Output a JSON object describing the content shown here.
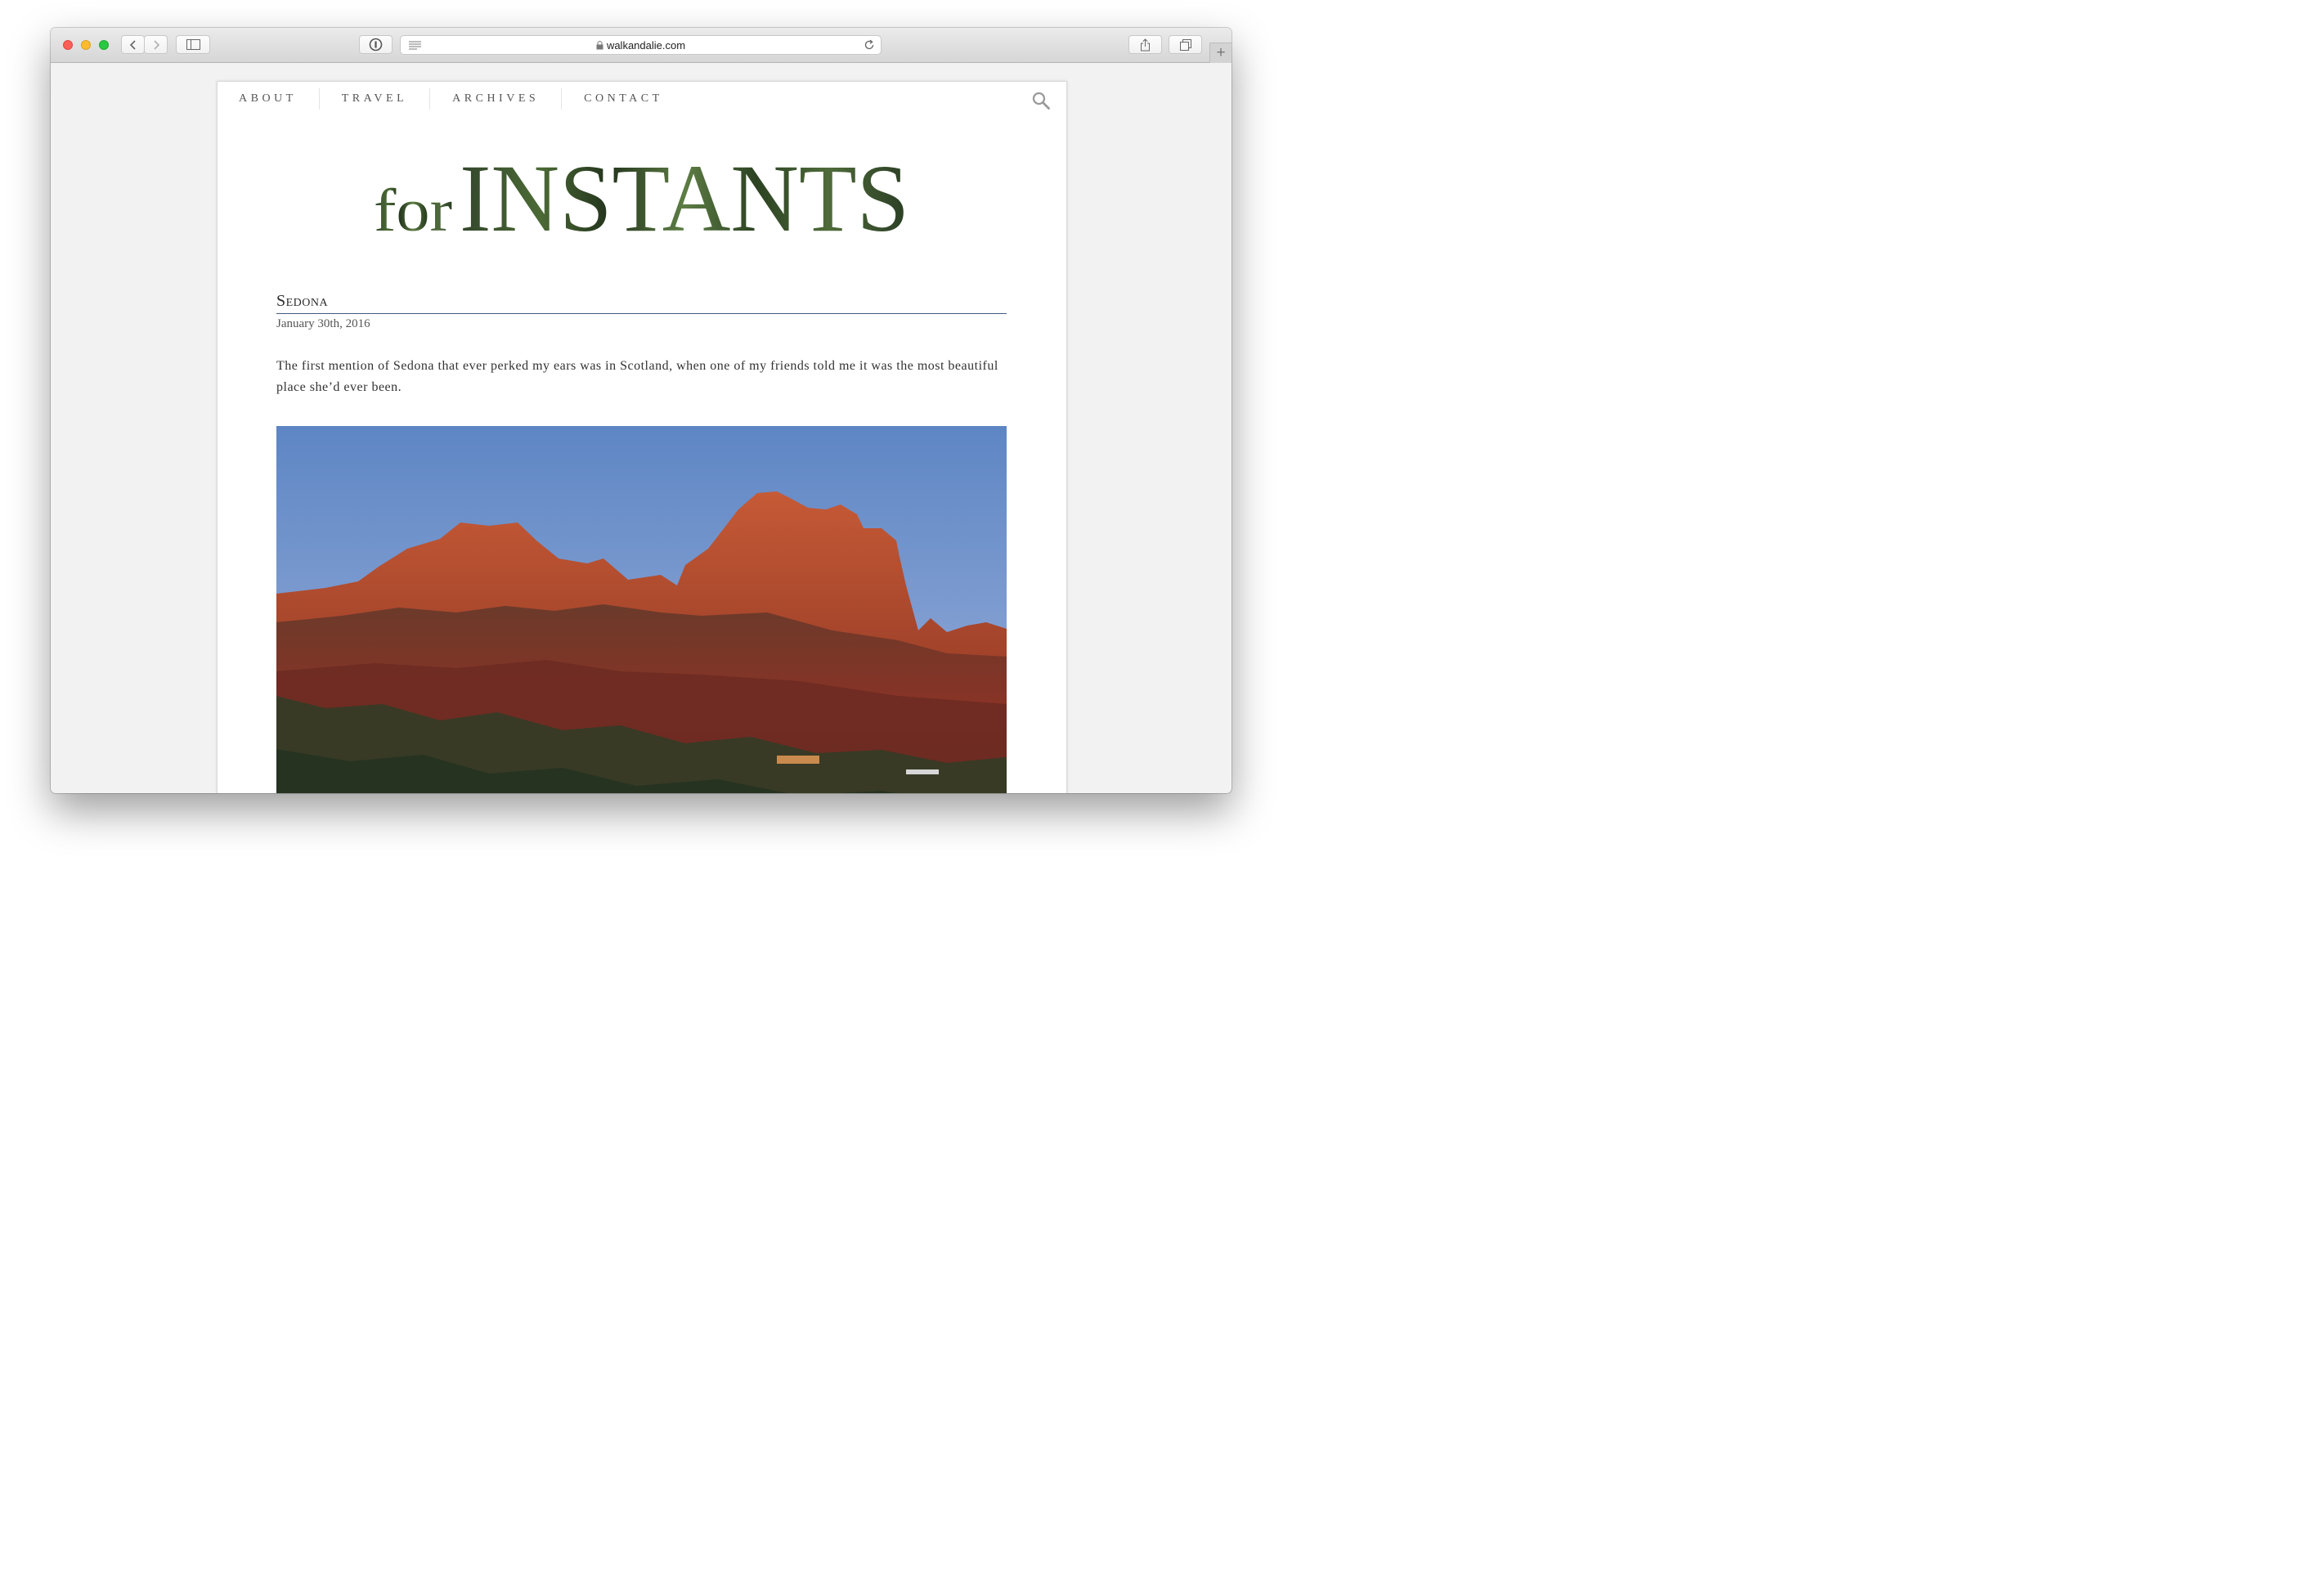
{
  "browser": {
    "url": "walkandalie.com"
  },
  "nav": {
    "items": [
      "ABOUT",
      "TRAVEL",
      "ARCHIVES",
      "CONTACT"
    ]
  },
  "logo": {
    "prefix": "for",
    "word": "INSTANTS"
  },
  "post": {
    "title": "Sedona",
    "date": "January 30th, 2016",
    "body": "The first mention of Sedona that ever perked my ears was in Scotland, when one of my friends told me it was the most beautiful place she’d ever been."
  },
  "colors": {
    "rule": "#3f5a80",
    "sky": "#6b8ec9",
    "rock": "#a33a22",
    "forest": "#2f4a2a"
  }
}
